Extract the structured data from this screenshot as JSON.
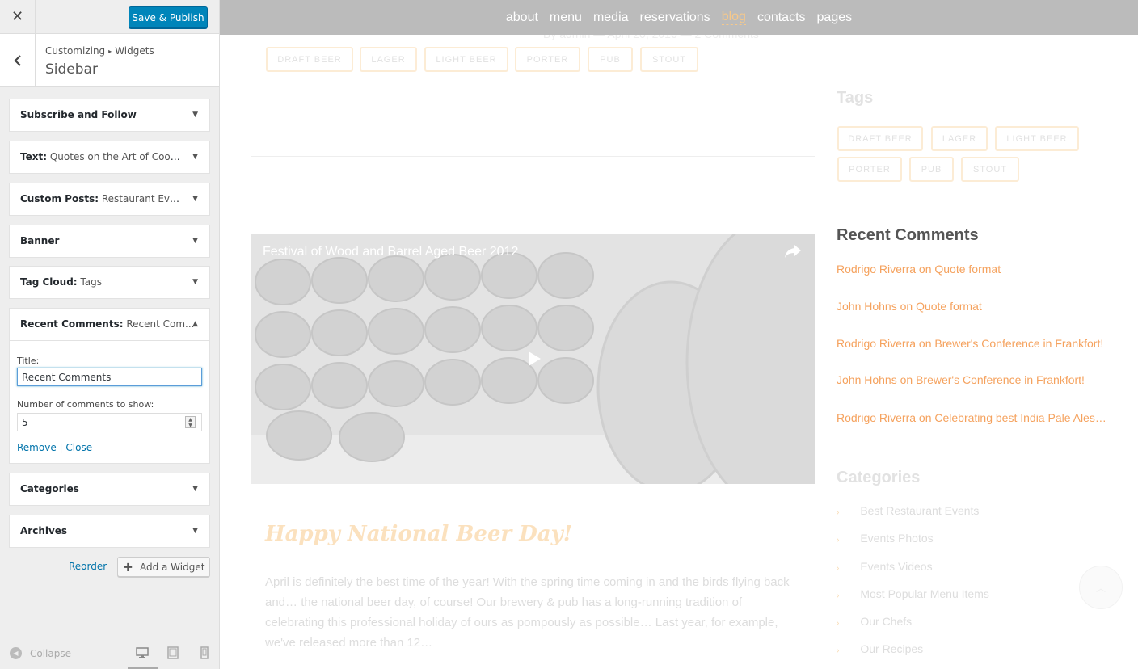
{
  "customizer": {
    "close_label": "✕",
    "publish_label": "Save & Publish",
    "breadcrumb": {
      "root": "Customizing",
      "separator": "▸",
      "current": "Widgets"
    },
    "section_title": "Sidebar",
    "widgets": [
      {
        "type": "Subscribe and Follow",
        "subtitle": ""
      },
      {
        "type": "Text:",
        "subtitle": "Quotes on the Art of Cooki..."
      },
      {
        "type": "Custom Posts:",
        "subtitle": "Restaurant Events"
      },
      {
        "type": "Banner",
        "subtitle": ""
      },
      {
        "type": "Tag Cloud:",
        "subtitle": "Tags"
      },
      {
        "type": "Recent Comments:",
        "subtitle": "Recent Com..."
      },
      {
        "type": "Categories",
        "subtitle": ""
      },
      {
        "type": "Archives",
        "subtitle": ""
      }
    ],
    "open_widget": {
      "title_label": "Title:",
      "title_value": "Recent Comments",
      "count_label": "Number of comments to show:",
      "count_value": "5",
      "remove_label": "Remove",
      "separator": "|",
      "close_label": "Close"
    },
    "reorder_label": "Reorder",
    "add_widget_label": "Add a Widget",
    "footer": {
      "collapse_label": "Collapse"
    }
  },
  "preview": {
    "nav": [
      "about",
      "menu",
      "media",
      "reservations",
      "blog",
      "contacts",
      "pages"
    ],
    "active_nav": "blog",
    "post_meta": "By admin   —   April 20, 2016   —   2 Comments",
    "post_tags": [
      "DRAFT BEER",
      "LAGER",
      "LIGHT BEER",
      "PORTER",
      "PUB",
      "STOUT"
    ],
    "video_title": "Festival of Wood and Barrel Aged Beer 2012",
    "post_title": "Happy National Beer Day!",
    "post_excerpt": "April is definitely the best time of the year! With the spring time coming in and the birds flying back and… the national beer day, of course! Our brewery & pub has a long-running tradition of celebrating this professional holiday of ours as pompously as possible… Last year, for example, we've released more than 12…",
    "tags_heading": "Tags",
    "sidebar_tags": [
      "DRAFT BEER",
      "LAGER",
      "LIGHT BEER",
      "PORTER",
      "PUB",
      "STOUT"
    ],
    "recent_comments_heading": "Recent Comments",
    "recent_comments": [
      "Rodrigo Riverra on Quote format",
      "John Hohns on Quote format",
      "Rodrigo Riverra on Brewer's Conference in Frankfort!",
      "John Hohns on Brewer's Conference in Frankfort!",
      "Rodrigo Riverra on Celebrating best India Pale Ales…"
    ],
    "categories_heading": "Categories",
    "categories": [
      "Best Restaurant Events",
      "Events Photos",
      "Events Videos",
      "Most Popular Menu Items",
      "Our Chefs",
      "Our Recipes"
    ]
  },
  "colors": {
    "accent": "#0085ba",
    "link": "#0073aa",
    "brand_orange": "#f5a25e",
    "nav_bg": "#bbbbbb"
  }
}
